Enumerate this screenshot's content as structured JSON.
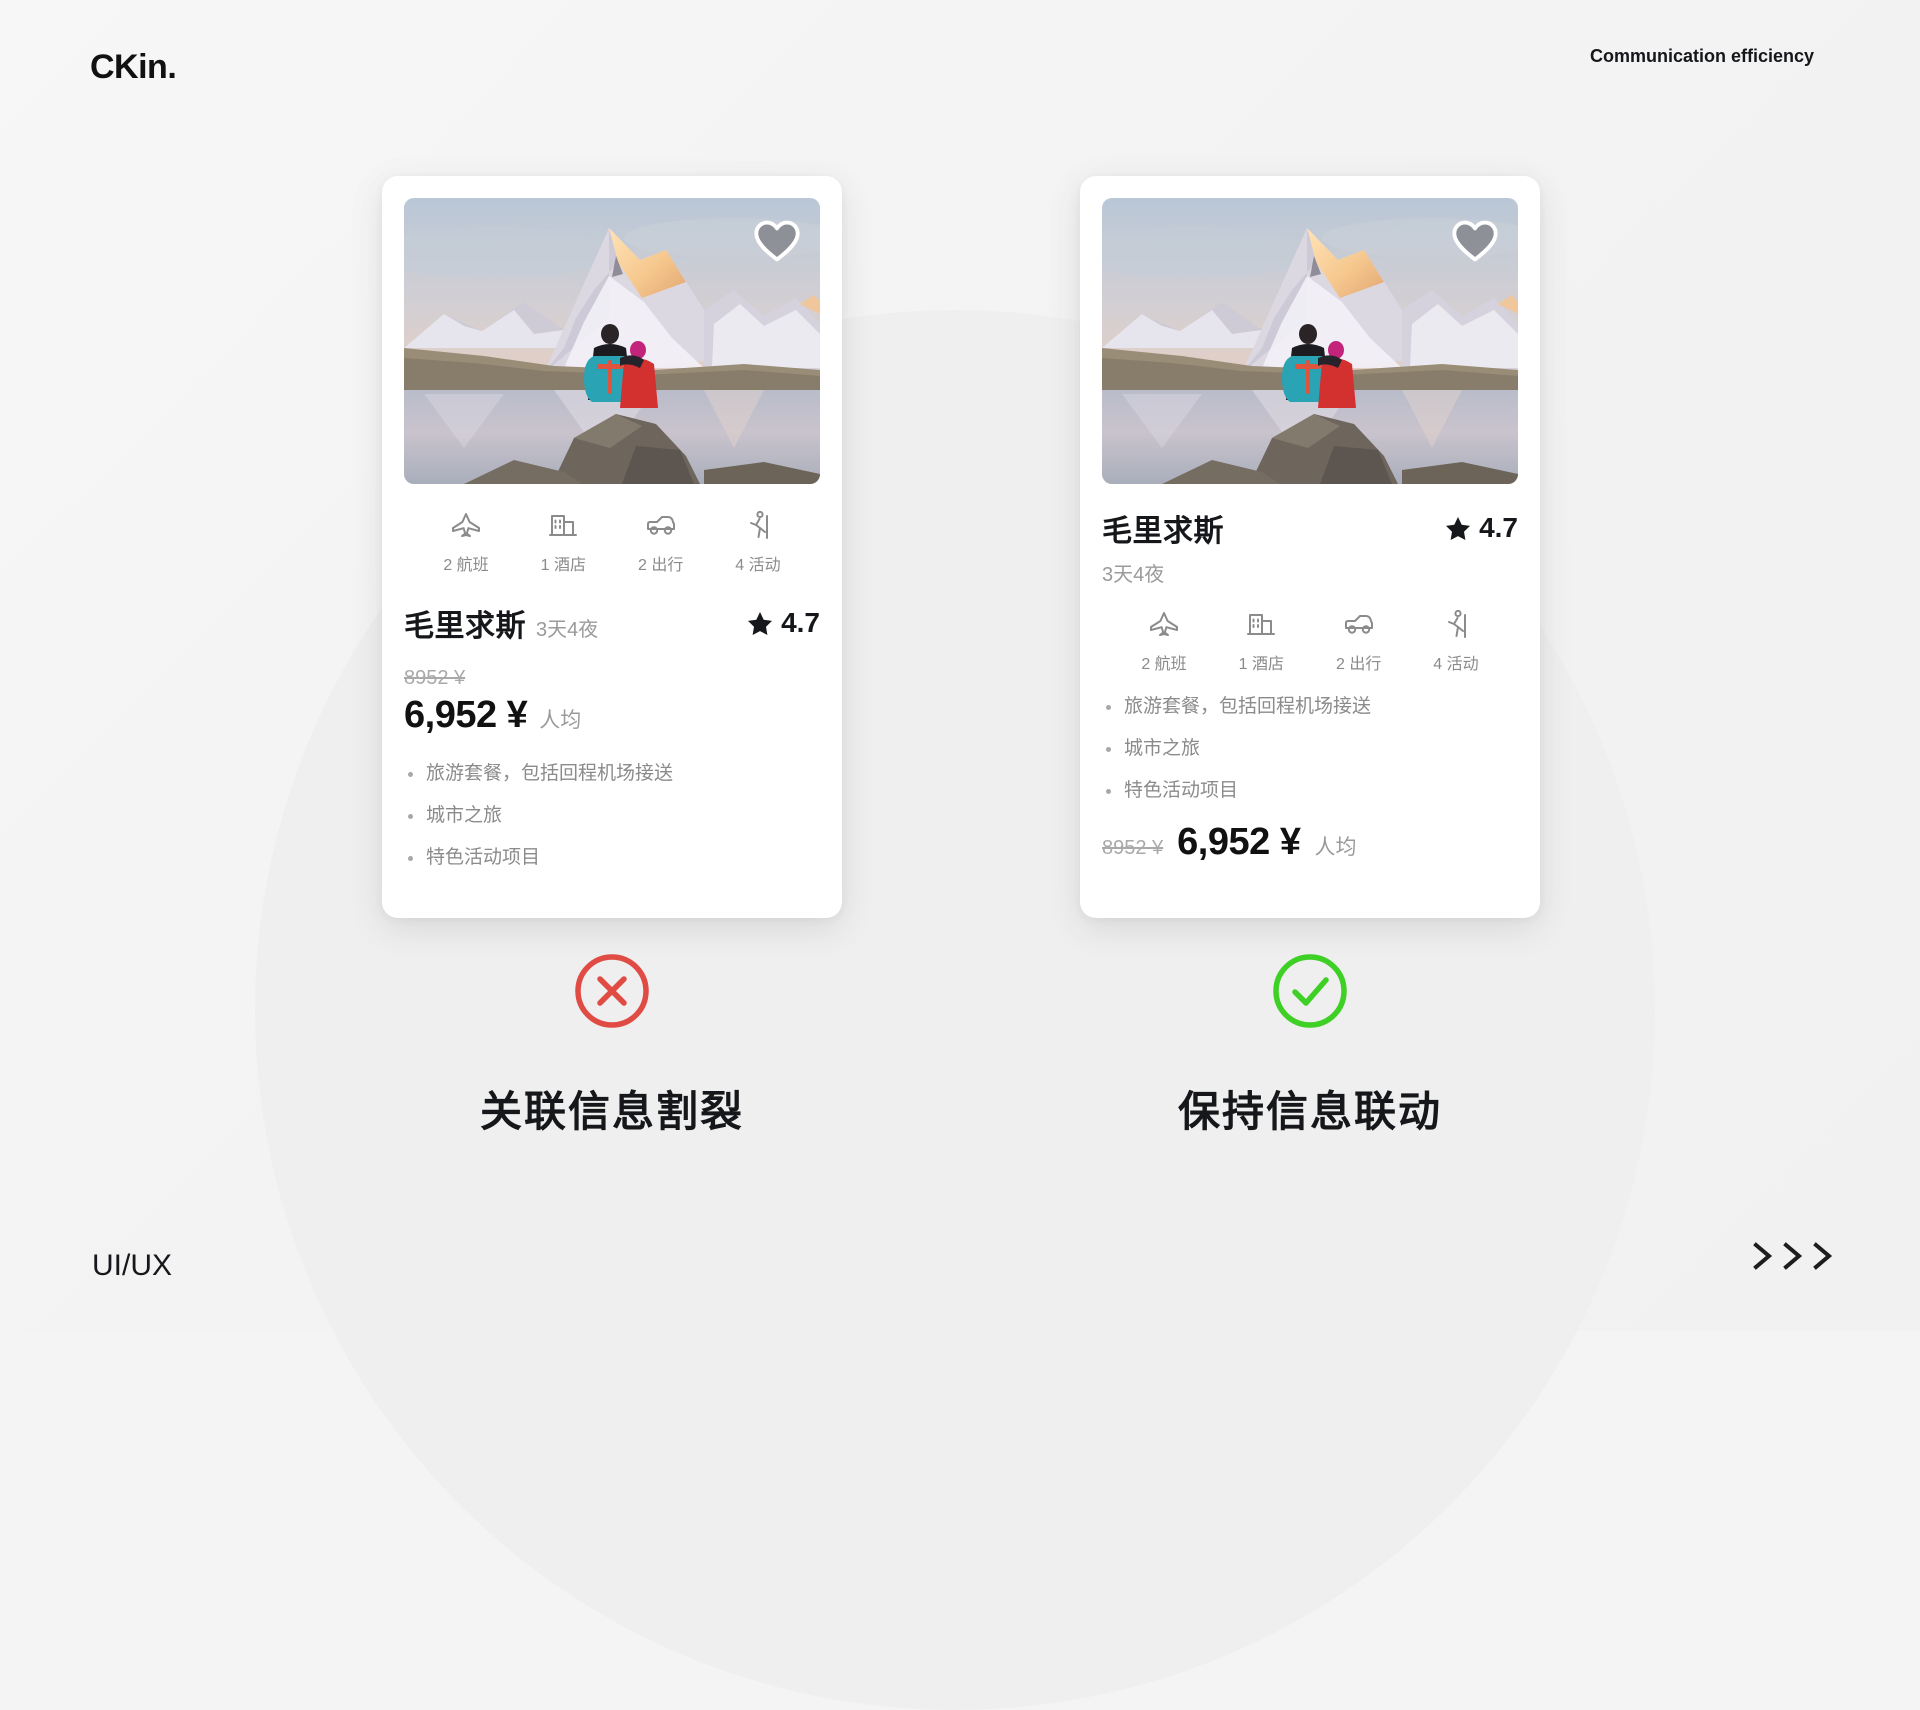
{
  "header": {
    "brand": "CKin.",
    "tagline": "Communication efficiency"
  },
  "footer": {
    "label": "UI/UX",
    "chevrons_icon": "chevron-double-right-icon"
  },
  "background": {
    "page_bg": "#f4f4f4",
    "arc_color": "#efefef"
  },
  "cards": [
    {
      "id": "bad",
      "photo": {
        "alt": "two hikers sitting on a rock by an alpine lake at sunrise with the Matterhorn behind",
        "favorite_icon": "heart-icon"
      },
      "features": [
        {
          "icon": "airplane-icon",
          "label": "2 航班"
        },
        {
          "icon": "hotel-icon",
          "label": "1 酒店"
        },
        {
          "icon": "car-icon",
          "label": "2 出行"
        },
        {
          "icon": "hiker-icon",
          "label": "4 活动"
        }
      ],
      "destination": "毛里求斯",
      "duration": "3天4夜",
      "rating": "4.7",
      "rating_icon": "star-icon",
      "old_price": "8952 ¥",
      "new_price": "6,952 ¥",
      "price_unit": "人均",
      "bullets": [
        "旅游套餐，包括回程机场接送",
        "城市之旅",
        "特色活动项目"
      ]
    },
    {
      "id": "good",
      "photo": {
        "alt": "two hikers sitting on a rock by an alpine lake at sunrise with the Matterhorn behind",
        "favorite_icon": "heart-icon"
      },
      "features": [
        {
          "icon": "airplane-icon",
          "label": "2 航班"
        },
        {
          "icon": "hotel-icon",
          "label": "1 酒店"
        },
        {
          "icon": "car-icon",
          "label": "2 出行"
        },
        {
          "icon": "hiker-icon",
          "label": "4 活动"
        }
      ],
      "destination": "毛里求斯",
      "duration": "3天4夜",
      "rating": "4.7",
      "rating_icon": "star-icon",
      "old_price": "8952 ¥",
      "new_price": "6,952 ¥",
      "price_unit": "人均",
      "bullets": [
        "旅游套餐，包括回程机场接送",
        "城市之旅",
        "特色活动项目"
      ]
    }
  ],
  "verdicts": [
    {
      "icon": "circle-cross-icon",
      "color": "#e04b44",
      "caption": "关联信息割裂"
    },
    {
      "icon": "circle-check-icon",
      "color": "#3ed024",
      "caption": "保持信息联动"
    }
  ]
}
